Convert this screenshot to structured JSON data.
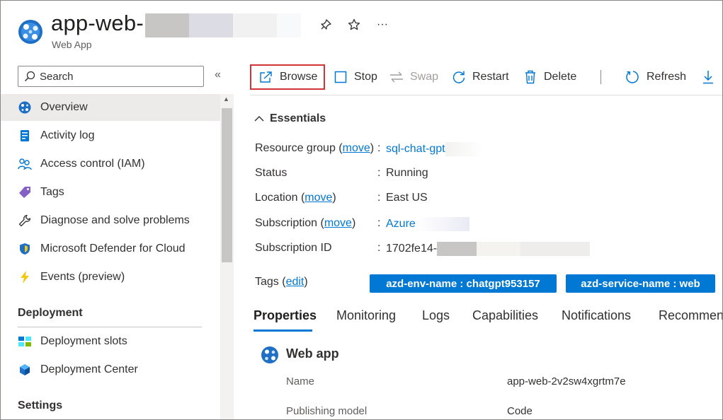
{
  "header": {
    "title": "app-web-",
    "subtitle": "Web App",
    "more_label": "···"
  },
  "sidebar": {
    "search_placeholder": "Search",
    "collapse_label": "«",
    "items": [
      {
        "label": "Overview",
        "icon": "app-service-icon",
        "active": true
      },
      {
        "label": "Activity log",
        "icon": "activity-log-icon"
      },
      {
        "label": "Access control (IAM)",
        "icon": "people-icon"
      },
      {
        "label": "Tags",
        "icon": "tag-icon"
      },
      {
        "label": "Diagnose and solve problems",
        "icon": "wrench-icon"
      },
      {
        "label": "Microsoft Defender for Cloud",
        "icon": "shield-icon"
      },
      {
        "label": "Events (preview)",
        "icon": "lightning-icon"
      }
    ],
    "sections": [
      {
        "title": "Deployment",
        "items": [
          {
            "label": "Deployment slots",
            "icon": "deployment-slots-icon"
          },
          {
            "label": "Deployment Center",
            "icon": "cube-icon"
          }
        ]
      },
      {
        "title": "Settings",
        "items": []
      }
    ]
  },
  "toolbar": {
    "browse": "Browse",
    "stop": "Stop",
    "swap": "Swap",
    "restart": "Restart",
    "delete": "Delete",
    "refresh": "Refresh",
    "download_partial": "D"
  },
  "essentials": {
    "heading": "Essentials",
    "rows": [
      {
        "key": "Resource group",
        "link": "move",
        "value": "sql-chat-gpt",
        "value_is_link": true
      },
      {
        "key": "Status",
        "value": "Running"
      },
      {
        "key": "Location",
        "link": "move",
        "value": "East US"
      },
      {
        "key": "Subscription",
        "link": "move",
        "value": "Azure",
        "value_is_link": true
      },
      {
        "key": "Subscription ID",
        "value": "1702fe14-"
      }
    ],
    "tags_label": "Tags",
    "tags_edit": "edit",
    "tags": [
      "azd-env-name : chatgpt953157",
      "azd-service-name : web"
    ]
  },
  "tabs": [
    "Properties",
    "Monitoring",
    "Logs",
    "Capabilities",
    "Notifications",
    "Recommen"
  ],
  "properties": {
    "section_title": "Web app",
    "rows": [
      {
        "key": "Name",
        "value": "app-web-2v2sw4xgrtm7e"
      },
      {
        "key": "Publishing model",
        "value": "Code"
      }
    ]
  },
  "colors": {
    "accent": "#0078d4",
    "highlight_border": "#d13438",
    "active_nav_bg": "#edebe9"
  }
}
